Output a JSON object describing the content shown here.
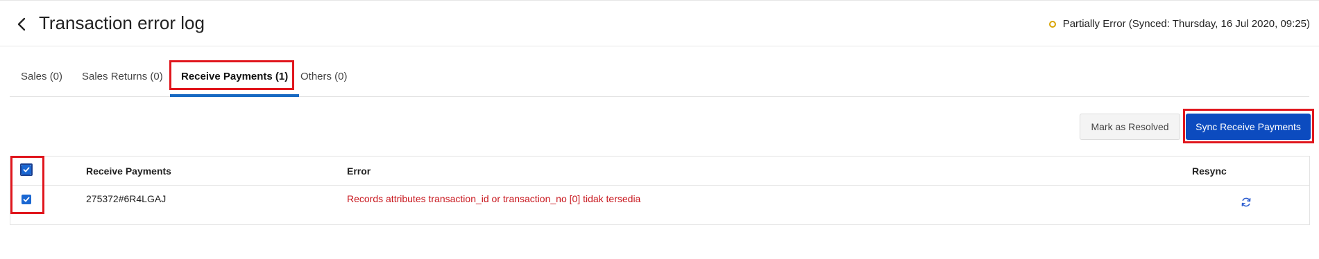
{
  "header": {
    "title": "Transaction error log",
    "status_text": "Partially Error (Synced: Thursday, 16 Jul 2020, 09:25)",
    "status_color": "#d9a400"
  },
  "tabs": [
    {
      "label": "Sales (0)",
      "active": false
    },
    {
      "label": "Sales Returns (0)",
      "active": false
    },
    {
      "label": "Receive Payments (1)",
      "active": true
    },
    {
      "label": "Others (0)",
      "active": false
    }
  ],
  "actions": {
    "mark_resolved_label": "Mark as Resolved",
    "sync_label": "Sync Receive Payments",
    "primary_color": "#0c4bbf"
  },
  "table": {
    "columns": [
      "Receive Payments",
      "Error",
      "Resync"
    ],
    "select_all_checked": true,
    "rows": [
      {
        "checked": true,
        "receive_payment": "275372#6R4LGAJ",
        "error": "Records attributes transaction_id or transaction_no [0] tidak tersedia",
        "resync_icon": "refresh-icon"
      }
    ]
  },
  "colors": {
    "error_text": "#c8161d",
    "tab_indicator": "#1769c2",
    "highlight_outline": "#e0161d"
  }
}
